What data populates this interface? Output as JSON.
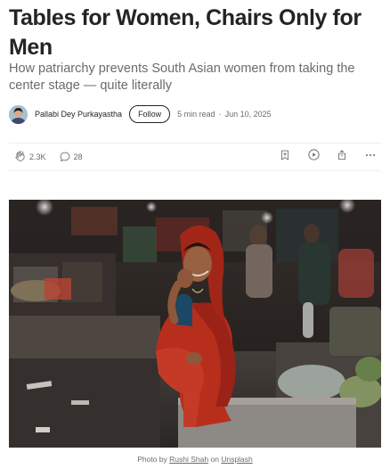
{
  "article": {
    "title": "Tables for Women, Chairs Only for Men",
    "subtitle": "How patriarchy prevents South Asian women from taking the center stage — quite literally",
    "author": "Pallabi Dey Purkayastha",
    "follow_label": "Follow",
    "read_time": "5 min read",
    "date": "Jun 10, 2025",
    "separator": "·"
  },
  "actions": {
    "claps": "2.3K",
    "responses": "28",
    "icons": [
      "clap-icon",
      "response-icon",
      "bookmark-icon",
      "listen-icon",
      "share-icon",
      "more-icon"
    ]
  },
  "photo": {
    "caption_prefix": "Photo by",
    "photographer": "Rushi Shah",
    "caption_mid": "on",
    "source": "Unsplash"
  },
  "colors": {
    "text": "#242424",
    "muted": "#6b6b6b",
    "divider": "#efefef",
    "sari_red": "#c8321f"
  }
}
